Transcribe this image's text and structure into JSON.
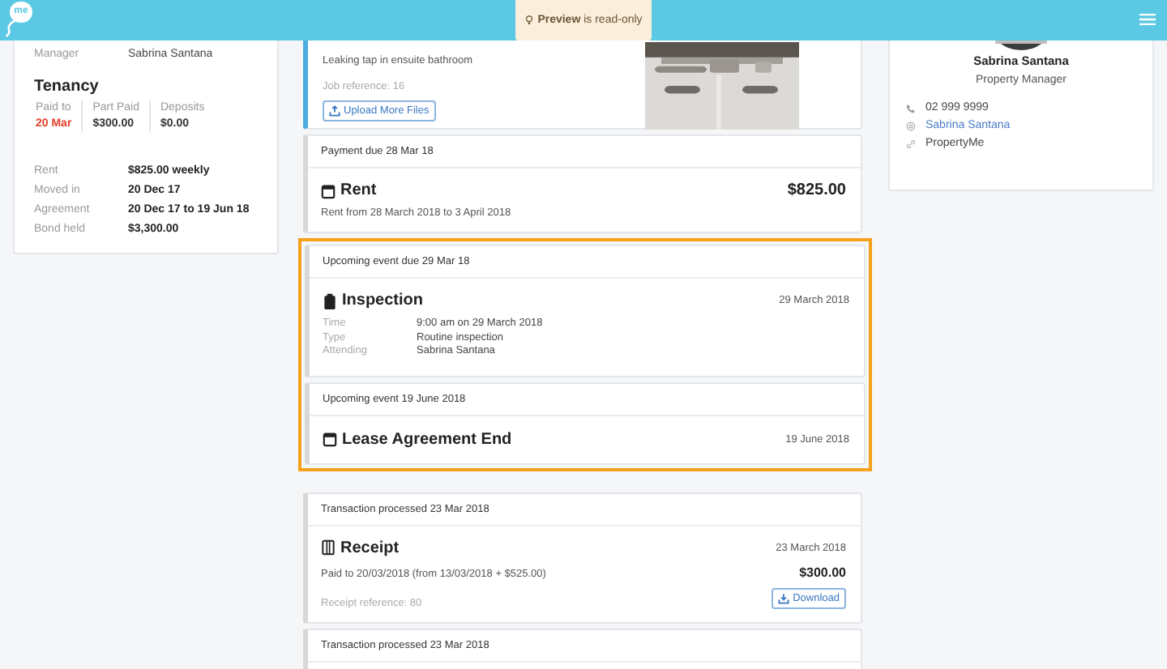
{
  "header": {
    "logo_text": "me",
    "notice": "**Preview** is read-only"
  },
  "left_card": {
    "manager": {
      "label": "Manager",
      "value": "Sabrina Santana"
    },
    "tenancy_title": "Tenancy",
    "stats": [
      {
        "label": "Paid to",
        "value": "20 Mar",
        "overdue": true
      },
      {
        "label": "Part Paid",
        "value": "$300.00",
        "overdue": false
      },
      {
        "label": "Deposits",
        "value": "$0.00",
        "overdue": false
      }
    ],
    "details": [
      {
        "label": "Rent",
        "value": "$825.00 weekly"
      },
      {
        "label": "Moved in",
        "value": "20 Dec 17"
      },
      {
        "label": "Agreement",
        "value": "20 Dec 17 to 19 Jun 18"
      },
      {
        "label": "Bond held",
        "value": "$3,300.00"
      }
    ]
  },
  "feed": [
    {
      "kind": "job",
      "description": "Leaking tap in ensuite bathroom",
      "reference": "Job reference: 16",
      "button": "Upload More Files"
    },
    {
      "kind": "payment",
      "header": "Payment due 28 Mar 18",
      "title": "Rent",
      "amount": "$825.00",
      "subtitle": "Rent from 28 March 2018 to 3 April 2018"
    },
    {
      "kind": "group",
      "highlighted": true,
      "items": [
        {
          "kind": "inspection",
          "header": "Upcoming event due 29 Mar 18",
          "title": "Inspection",
          "date": "29 March 2018",
          "details": [
            {
              "label": "Time",
              "value": "9:00 am on 29 March 2018"
            },
            {
              "label": "Type",
              "value": "Routine inspection"
            },
            {
              "label": "Attending",
              "value": "Sabrina Santana"
            }
          ]
        },
        {
          "kind": "lease_end",
          "header": "Upcoming event 19 June 2018",
          "title": "Lease Agreement End",
          "date": "19 June 2018"
        }
      ]
    },
    {
      "kind": "receipt",
      "header": "Transaction processed 23 Mar 2018",
      "title": "Receipt",
      "date": "23 March 2018",
      "subtitle": "Paid to 20/03/2018 (from 13/03/2018 + $525.00)",
      "amount": "$300.00",
      "reference": "Receipt reference: 80",
      "button": "Download"
    },
    {
      "kind": "transaction",
      "header": "Transaction processed 23 Mar 2018"
    }
  ],
  "contact_card": {
    "name": "Sabrina Santana",
    "role": "Property Manager",
    "lines": [
      {
        "kind": "phone",
        "text": "02 999 9999"
      },
      {
        "kind": "email",
        "text": "Sabrina Santana"
      },
      {
        "kind": "website",
        "text": "PropertyMe"
      }
    ]
  }
}
